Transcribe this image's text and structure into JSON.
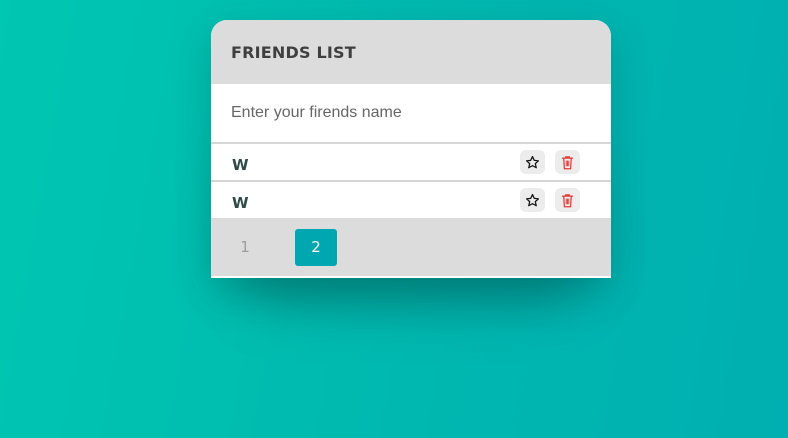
{
  "card": {
    "title": "FRIENDS LIST"
  },
  "input": {
    "placeholder": "Enter your firends name",
    "value": ""
  },
  "friends": [
    {
      "name": "W",
      "favorite_icon": "star-outline-icon",
      "delete_icon": "trash-icon"
    },
    {
      "name": "W",
      "favorite_icon": "star-outline-icon",
      "delete_icon": "trash-icon"
    }
  ],
  "pagination": {
    "pages": [
      "1",
      "2"
    ],
    "current": "2"
  },
  "colors": {
    "background_start": "#00c7b1",
    "background_end": "#00afb1",
    "header_bg": "#dcdcdc",
    "active_page": "#00a7b0",
    "delete_icon": "#e53935",
    "friend_name": "#2e4a4a"
  }
}
